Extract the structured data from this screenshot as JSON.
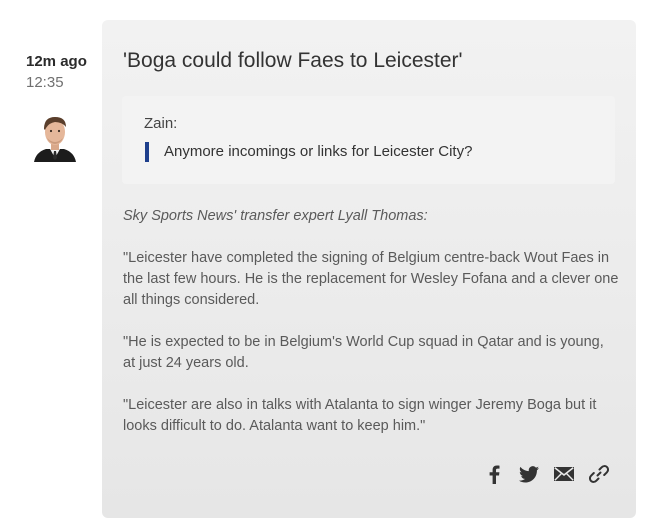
{
  "meta": {
    "relative_time": "12m ago",
    "clock_time": "12:35"
  },
  "post": {
    "headline": "'Boga could follow Faes to Leicester'",
    "question": {
      "asker": "Zain:",
      "text": "Anymore incomings or links for Leicester City?"
    },
    "paragraphs": [
      "Sky Sports News' transfer expert Lyall Thomas:",
      "\"Leicester have completed the signing of Belgium centre-back Wout Faes in the last few hours. He is the replacement for Wesley Fofana and a clever one all things considered.",
      "\"He is expected to be in Belgium's World Cup squad in Qatar and is young, at just 24 years old.",
      "\"Leicester are also in talks with Atalanta to sign winger Jeremy Boga but it looks difficult to do. Atalanta want to keep him.\""
    ]
  },
  "share_icons": [
    "facebook-icon",
    "twitter-icon",
    "email-icon",
    "link-icon"
  ],
  "colors": {
    "question_bar": "#1e3f8c",
    "icon": "#333333"
  }
}
